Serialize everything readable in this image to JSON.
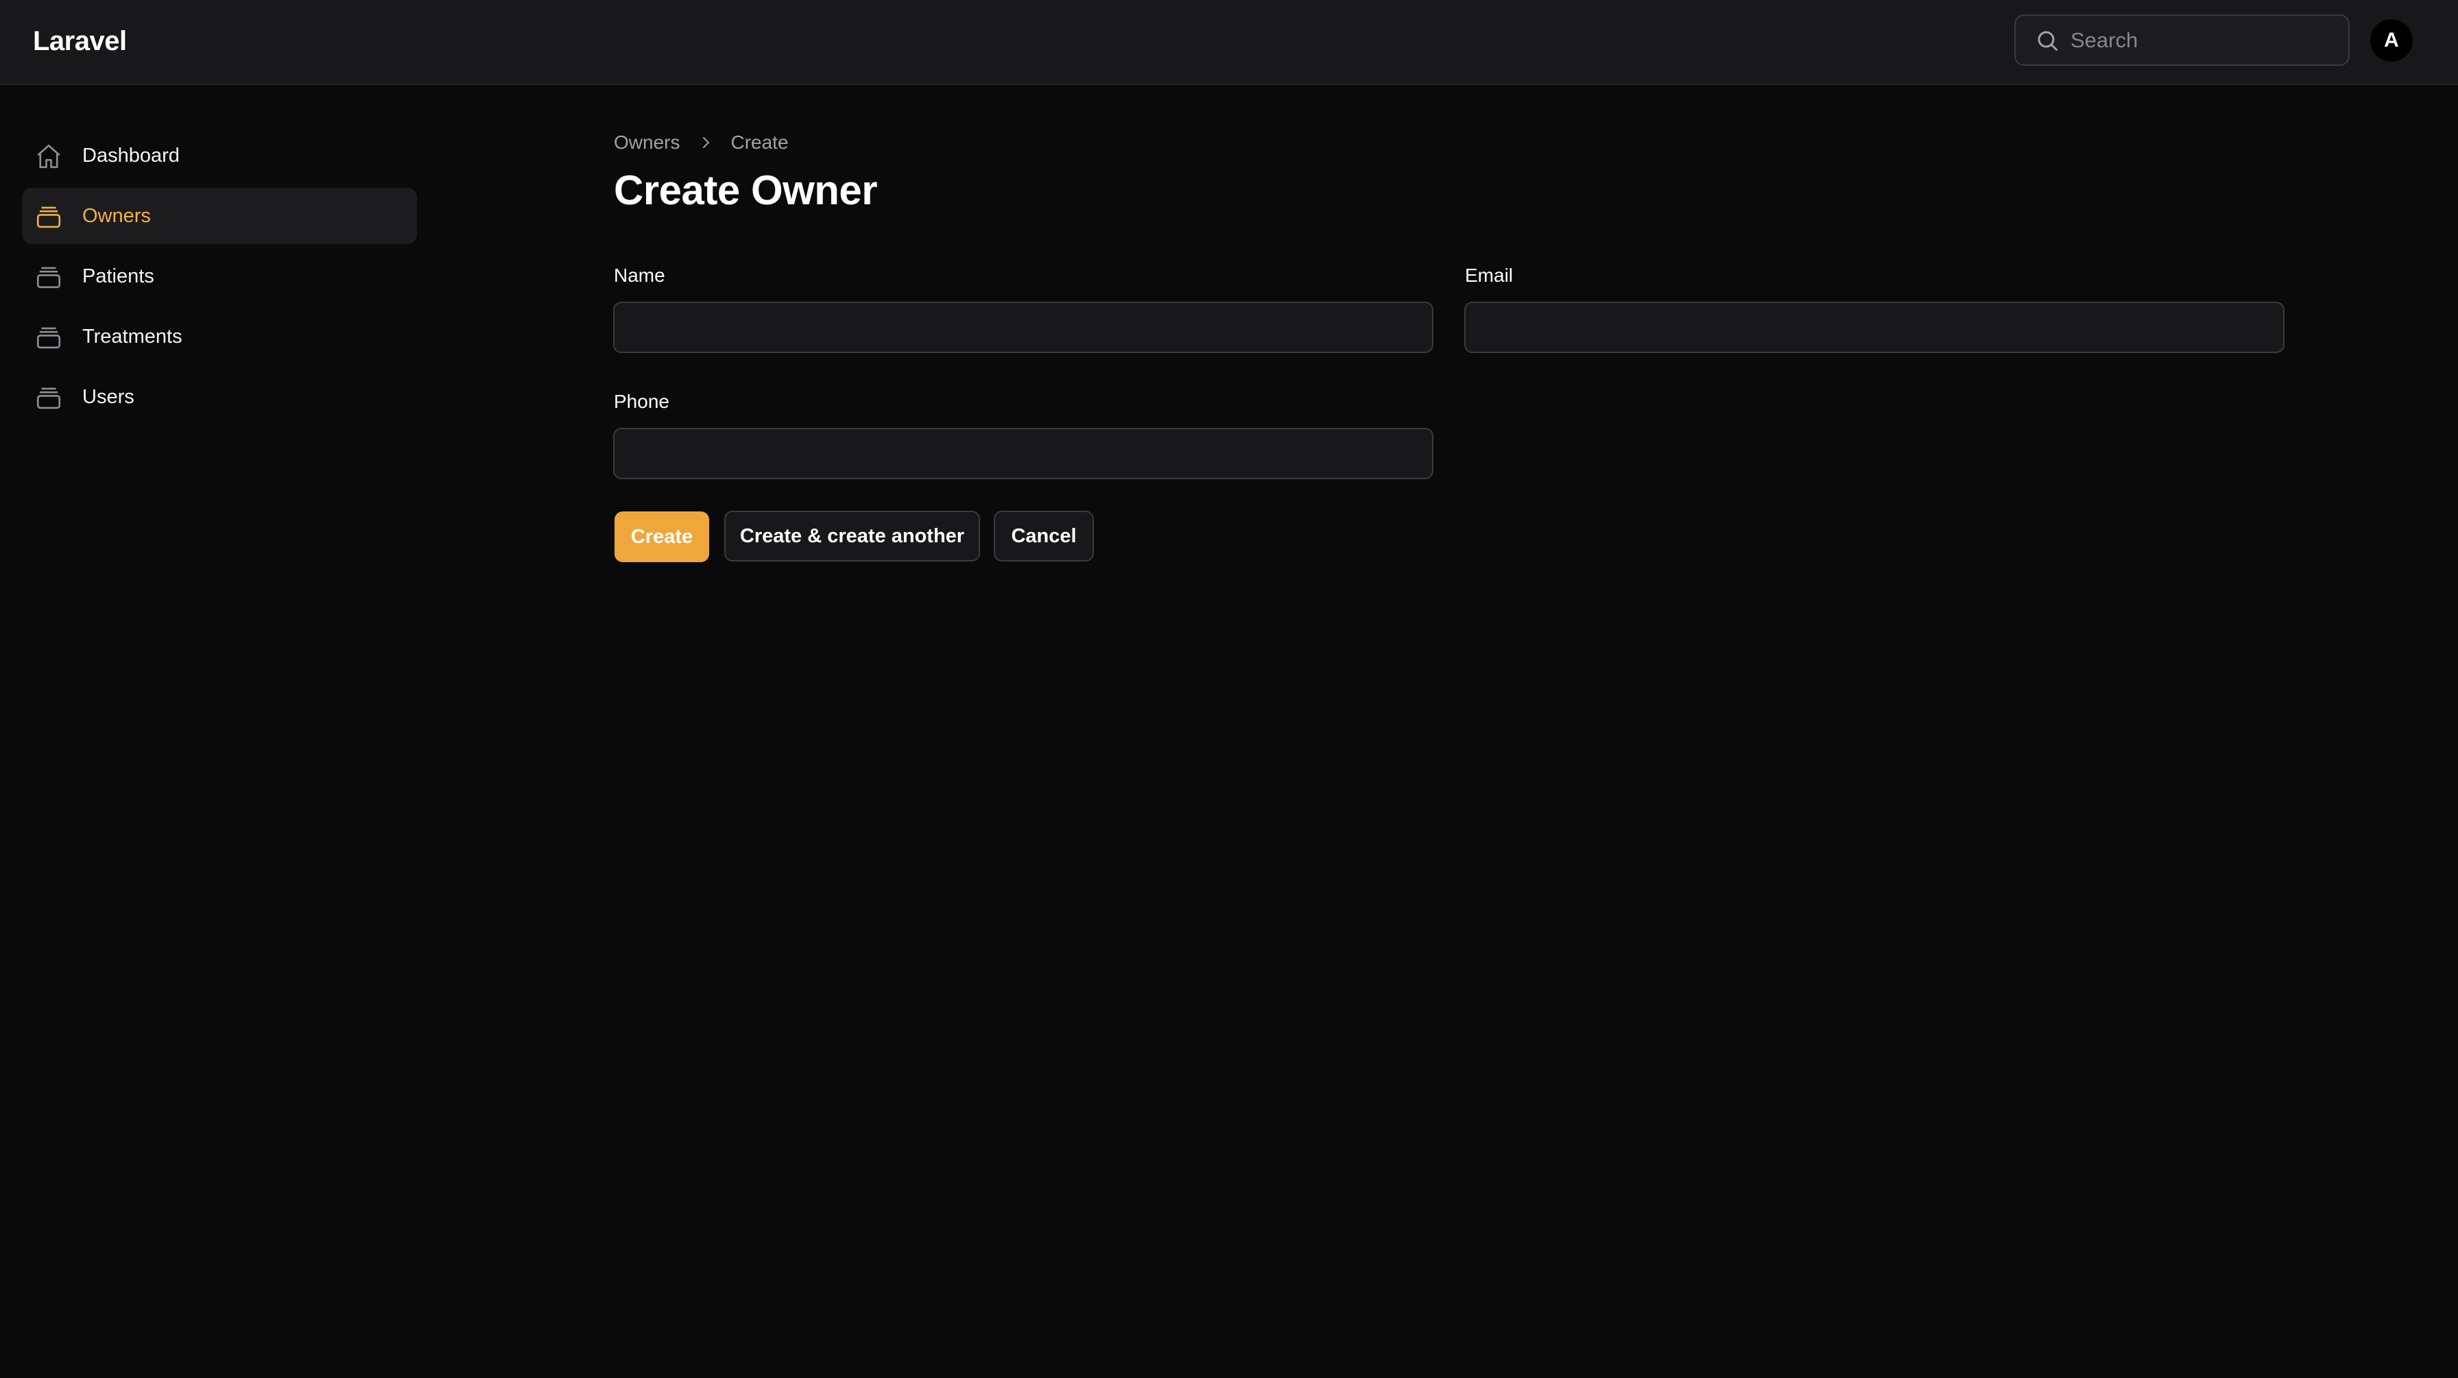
{
  "app": {
    "brand": "Laravel"
  },
  "header": {
    "search": {
      "placeholder": "Search",
      "value": "",
      "icon": "search-icon"
    },
    "avatar_initial": "A"
  },
  "sidebar": {
    "items": [
      {
        "label": "Dashboard",
        "icon": "home-icon",
        "active": false
      },
      {
        "label": "Owners",
        "icon": "stack-icon",
        "active": true
      },
      {
        "label": "Patients",
        "icon": "stack-icon",
        "active": false
      },
      {
        "label": "Treatments",
        "icon": "stack-icon",
        "active": false
      },
      {
        "label": "Users",
        "icon": "stack-icon",
        "active": false
      }
    ]
  },
  "breadcrumb": {
    "items": [
      "Owners",
      "Create"
    ]
  },
  "page": {
    "title": "Create Owner"
  },
  "form": {
    "name": {
      "label": "Name",
      "value": ""
    },
    "email": {
      "label": "Email",
      "value": ""
    },
    "phone": {
      "label": "Phone",
      "value": ""
    }
  },
  "actions": {
    "create": "Create",
    "create_another": "Create & create another",
    "cancel": "Cancel"
  },
  "colors": {
    "accent": "#efa63b",
    "background": "#0a0a0b",
    "topbar": "#18181b"
  }
}
